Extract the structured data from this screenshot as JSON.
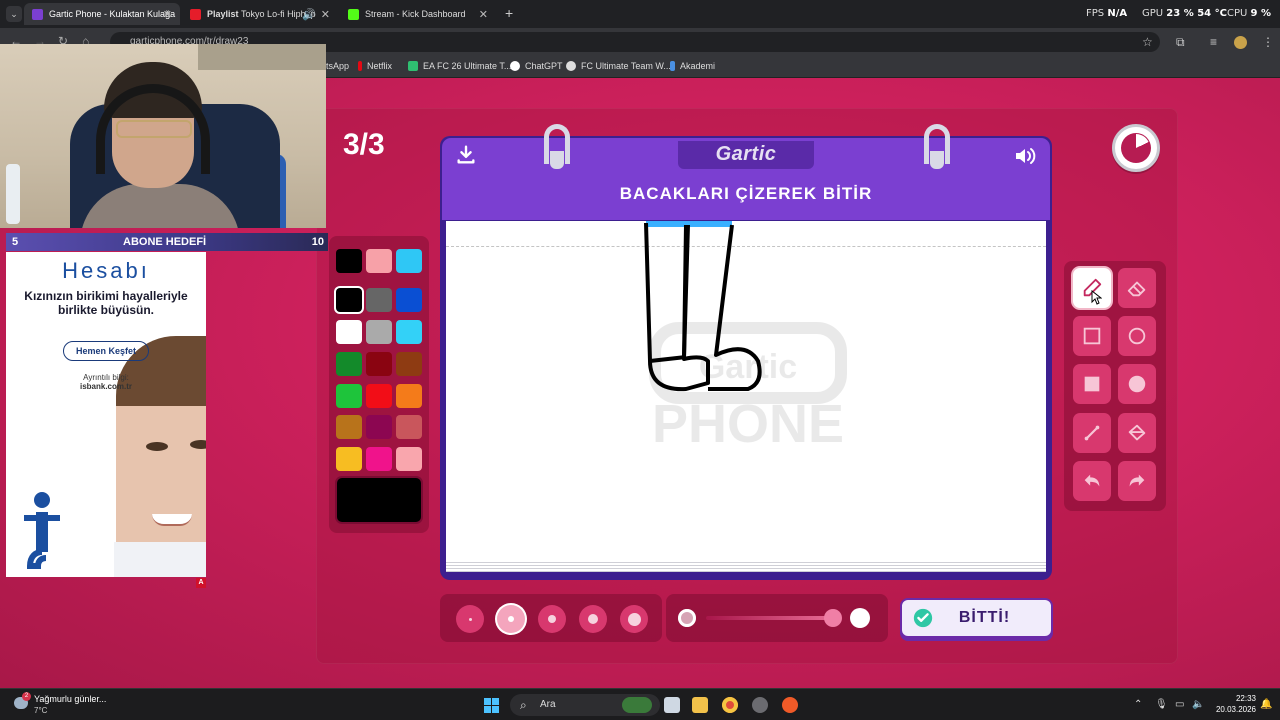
{
  "browser": {
    "tabs": [
      {
        "title": "Gartic Phone - Kulaktan Kulağa",
        "active": true
      },
      {
        "title_prefix": "Playlist",
        "title": "Tokyo Lo-fi Hiphop",
        "active": false
      },
      {
        "title": "Stream - Kick Dashboard",
        "active": false
      }
    ],
    "new_tab": "+",
    "perf": {
      "fps_label": "FPS",
      "fps_value": "N/A",
      "gpu_label": "GPU",
      "gpu_value": "23 % 54 °C",
      "cpu_label": "CPU",
      "cpu_value": "9 %"
    },
    "url": "garticphone.com/tr/draw23",
    "bookmarks": [
      "tsApp",
      "Netflix",
      "EA FC 26 Ultimate T...",
      "ChatGPT",
      "FC Ultimate Team W...",
      "Akademi"
    ]
  },
  "game": {
    "round": "3/3",
    "logo": "Gartic",
    "instruction": "BACAKLARI ÇİZEREK BİTİR",
    "done_label": "BİTTİ!",
    "watermark": "Gartic PHONE",
    "timer_elapsed_fraction": 0.82,
    "opacity_level": 0.9,
    "selected_color": "#000000",
    "selected_tool": "pen",
    "selected_size_index": 1,
    "palette": [
      "#000000",
      "#f7a1a8",
      "#2fc7f5",
      "#000000",
      "#666666",
      "#0a4fd3",
      "#ffffff",
      "#aaaaaa",
      "#33d1f7",
      "#138a2a",
      "#8a0411",
      "#8e3b12",
      "#1ec43b",
      "#f20d17",
      "#f47b1a",
      "#b8731b",
      "#8c0651",
      "#c9565c",
      "#f7bd22",
      "#f0138b",
      "#f9a6ad"
    ],
    "tools": [
      "pen",
      "eraser",
      "rectangle-outline",
      "ellipse-outline",
      "rectangle-filled",
      "ellipse-filled",
      "line",
      "fill-bucket",
      "undo",
      "redo"
    ]
  },
  "stream": {
    "sub_goal": {
      "current": "5",
      "label": "ABONE HEDEFİ",
      "target": "10"
    },
    "ad": {
      "title": "Hesabı",
      "text": "Kızınızın birikimi hayalleriyle birlikte büyüsün.",
      "button": "Hemen Keşfet",
      "info": "Ayrıntılı bilgi:",
      "info_url": "isbank.com.tr",
      "badge": "A"
    }
  },
  "taskbar": {
    "weather_text": "Yağmurlu günler...",
    "weather_temp": "7°C",
    "weather_badge": "2",
    "search_placeholder": "Ara",
    "time": "22:33",
    "date": "20.03.2026"
  }
}
